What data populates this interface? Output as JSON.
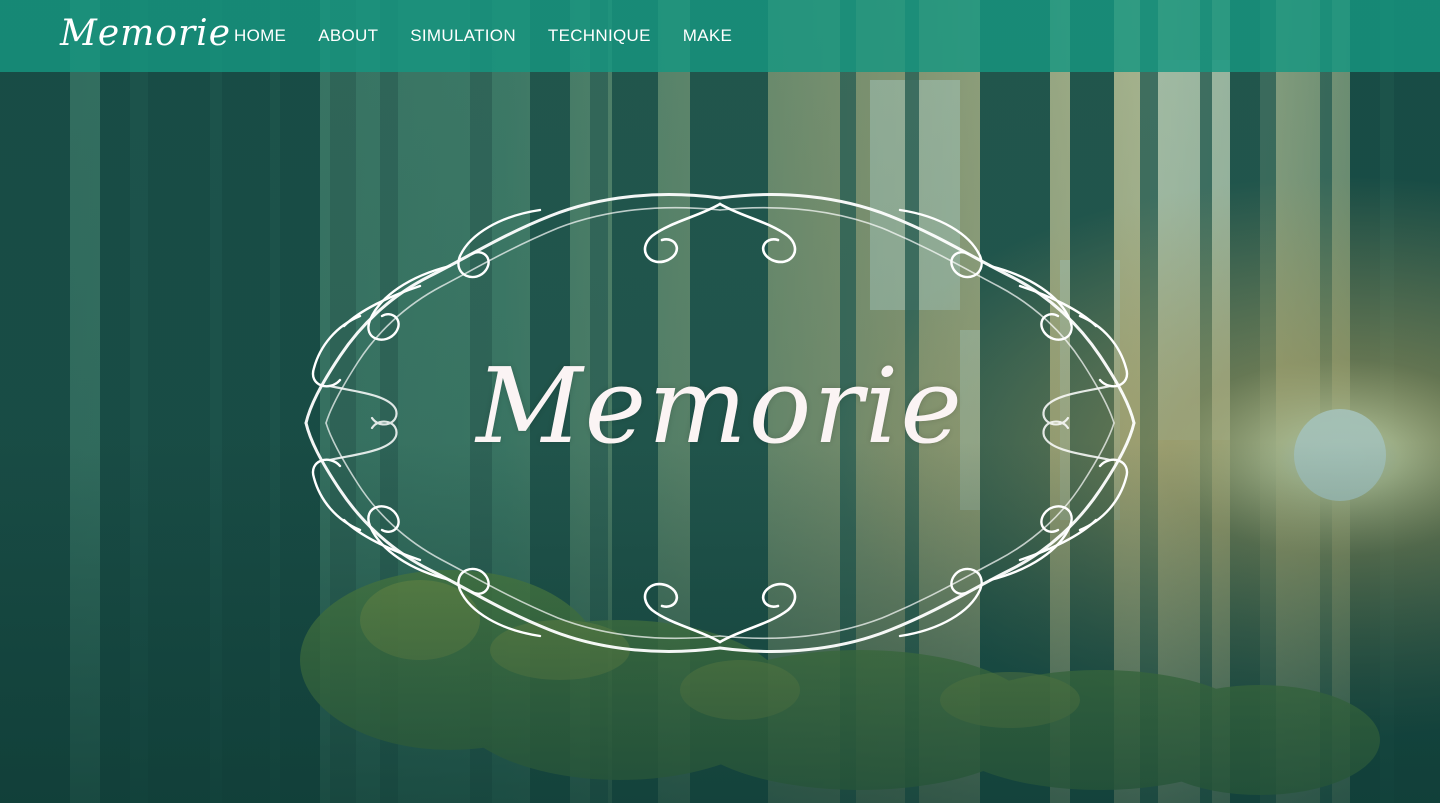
{
  "nav": {
    "logo": "Memorie",
    "links": [
      "HOME",
      "ABOUT",
      "SIMULATION",
      "TECHNIQUE",
      "MAKE"
    ]
  },
  "hero": {
    "title": "Memorie"
  },
  "colors": {
    "nav_background": "#169680",
    "nav_text": "#ffffff",
    "title_text": "#fbf4f4",
    "forest_dark": "#1c4640",
    "sunlight": "#ffd98a"
  },
  "icons": {
    "frame": "ornamental-scroll-frame"
  }
}
